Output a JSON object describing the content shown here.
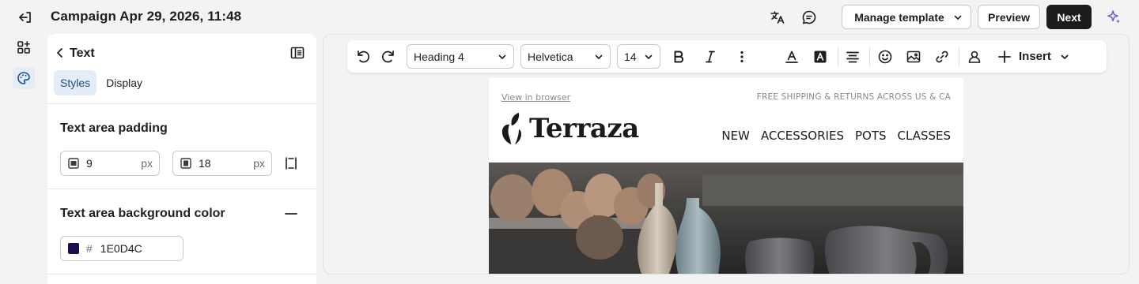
{
  "header": {
    "title": "Campaign Apr 29, 2026, 11:48",
    "manage_template_label": "Manage template",
    "preview_label": "Preview",
    "next_label": "Next"
  },
  "panel": {
    "back_title": "Text",
    "tabs": [
      {
        "label": "Styles",
        "active": true
      },
      {
        "label": "Display",
        "active": false
      }
    ],
    "padding": {
      "title": "Text area padding",
      "vertical_value": "9",
      "horizontal_value": "18",
      "unit": "px"
    },
    "background": {
      "title": "Text area background color",
      "hash": "#",
      "value": "1E0D4C",
      "swatch_color": "#1E0D4C"
    }
  },
  "toolbar": {
    "block_style": "Heading 4",
    "font": "Helvetica",
    "size": "14",
    "insert_label": "Insert"
  },
  "email": {
    "view_in_browser": "View in browser",
    "shipping_note": "FREE SHIPPING & RETURNS ACROSS US & CA",
    "brand": "Terraza",
    "nav": [
      "NEW",
      "ACCESSORIES",
      "POTS",
      "CLASSES"
    ]
  },
  "colors": {
    "accent": "#1e4e8c",
    "active_bg": "#e3ecf7",
    "dark_button": "#1c1c1c",
    "sparkle": "#6b5bd6"
  }
}
